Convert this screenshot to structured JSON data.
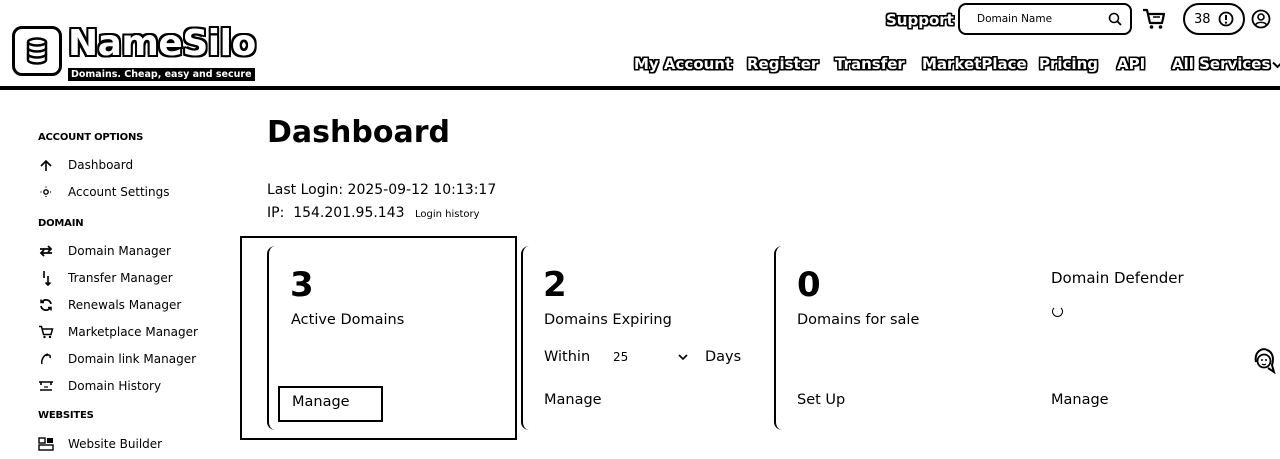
{
  "header": {
    "logo_name": "NameSilo",
    "logo_tagline": "Domains. Cheap, easy and secure",
    "support_label": "Support",
    "search_placeholder": "Domain Name",
    "counter_value": "38",
    "nav": [
      "My Account",
      "Register",
      "Transfer",
      "MarketPlace",
      "Pricing",
      "API",
      "All Services"
    ]
  },
  "sidebar": {
    "sections": [
      {
        "heading": "ACCOUNT OPTIONS",
        "items": [
          {
            "label": "Dashboard",
            "icon": "arrow-up-icon"
          },
          {
            "label": "Account Settings",
            "icon": "gear-icon"
          }
        ]
      },
      {
        "heading": "DOMAIN",
        "items": [
          {
            "label": "Domain Manager",
            "icon": "swap-icon"
          },
          {
            "label": "Transfer Manager",
            "icon": "transfer-icon"
          },
          {
            "label": "Renewals Manager",
            "icon": "refresh-icon"
          },
          {
            "label": "Marketplace Manager",
            "icon": "cart-icon"
          },
          {
            "label": "Domain link Manager",
            "icon": "link-icon"
          },
          {
            "label": "Domain History",
            "icon": "history-icon"
          }
        ]
      },
      {
        "heading": "WEBSITES",
        "items": [
          {
            "label": "Website Builder",
            "icon": "builder-icon"
          }
        ]
      }
    ]
  },
  "main": {
    "title": "Dashboard",
    "last_login": "Last Login: 2025-09-12 10:13:17",
    "ip_label": "IP:",
    "ip_value": "154.201.95.143",
    "login_history": "Login history",
    "cards": {
      "active": {
        "number": "3",
        "label": "Active Domains",
        "link": "Manage"
      },
      "expiring": {
        "number": "2",
        "label": "Domains Expiring",
        "within": "Within",
        "days_value": "25",
        "days": "Days",
        "link": "Manage"
      },
      "sale": {
        "number": "0",
        "label": "Domains for sale",
        "link": "Set Up"
      },
      "defender": {
        "title": "Domain Defender",
        "link": "Manage"
      }
    }
  }
}
